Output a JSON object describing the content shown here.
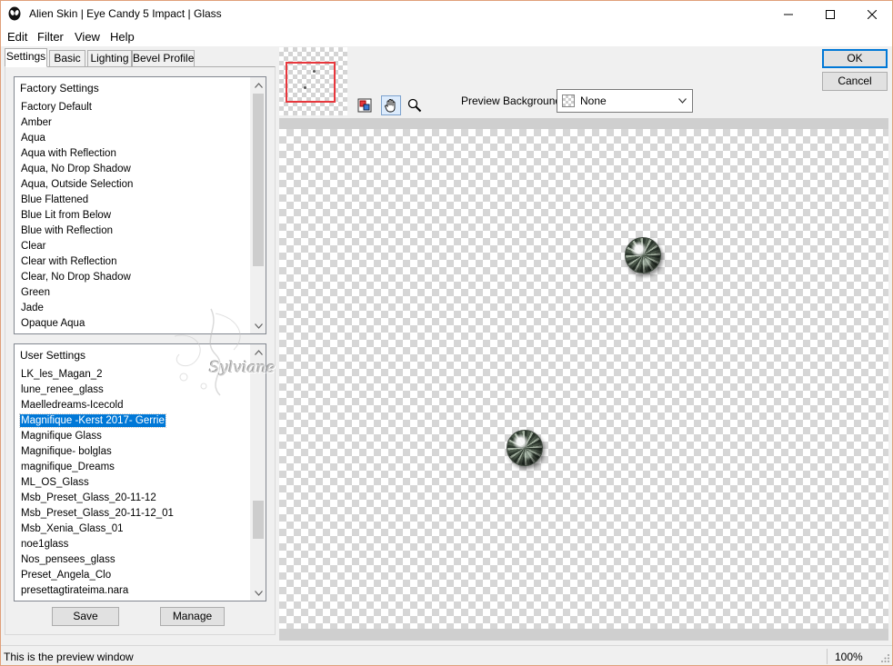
{
  "window": {
    "title": "Alien Skin | Eye Candy 5 Impact | Glass"
  },
  "menu": {
    "items": [
      {
        "label": "Edit"
      },
      {
        "label": "Filter"
      },
      {
        "label": "View"
      },
      {
        "label": "Help"
      }
    ]
  },
  "tabs": [
    {
      "label": "Settings",
      "active": true
    },
    {
      "label": "Basic",
      "active": false
    },
    {
      "label": "Lighting",
      "active": false
    },
    {
      "label": "Bevel Profile",
      "active": false
    }
  ],
  "factory_settings": {
    "header": "Factory Settings",
    "items": [
      "Factory Default",
      "Amber",
      "Aqua",
      "Aqua with Reflection",
      "Aqua, No Drop Shadow",
      "Aqua, Outside Selection",
      "Blue Flattened",
      "Blue Lit from Below",
      "Blue with Reflection",
      "Clear",
      "Clear with Reflection",
      "Clear, No Drop Shadow",
      "Green",
      "Jade",
      "Opaque Aqua"
    ]
  },
  "user_settings": {
    "header": "User Settings",
    "selected_index": 3,
    "items": [
      "LK_les_Magan_2",
      "lune_renee_glass",
      "Maelledreams-Icecold",
      "Magnifique -Kerst 2017- Gerrie",
      "Magnifique Glass",
      "Magnifique- bolglas",
      "magnifique_Dreams",
      "ML_OS_Glass",
      "Msb_Preset_Glass_20-11-12",
      "Msb_Preset_Glass_20-11-12_01",
      "Msb_Xenia_Glass_01",
      "noe1glass",
      "Nos_pensees_glass",
      "Preset_Angela_Clo",
      "presettagtirateima.nara"
    ]
  },
  "buttons": {
    "save": "Save",
    "manage": "Manage",
    "ok": "OK",
    "cancel": "Cancel"
  },
  "preview": {
    "background_label": "Preview Background:",
    "background_value": "None",
    "tools": [
      "navigate-icon",
      "hand-icon",
      "zoom-icon"
    ]
  },
  "status": {
    "text": "This is the preview window",
    "zoom": "100%"
  },
  "watermark": {
    "text": "Sylviane"
  },
  "colors": {
    "selection": "#0078d7",
    "nav_rect": "#e8373c",
    "window_border": "#e0a07a"
  }
}
